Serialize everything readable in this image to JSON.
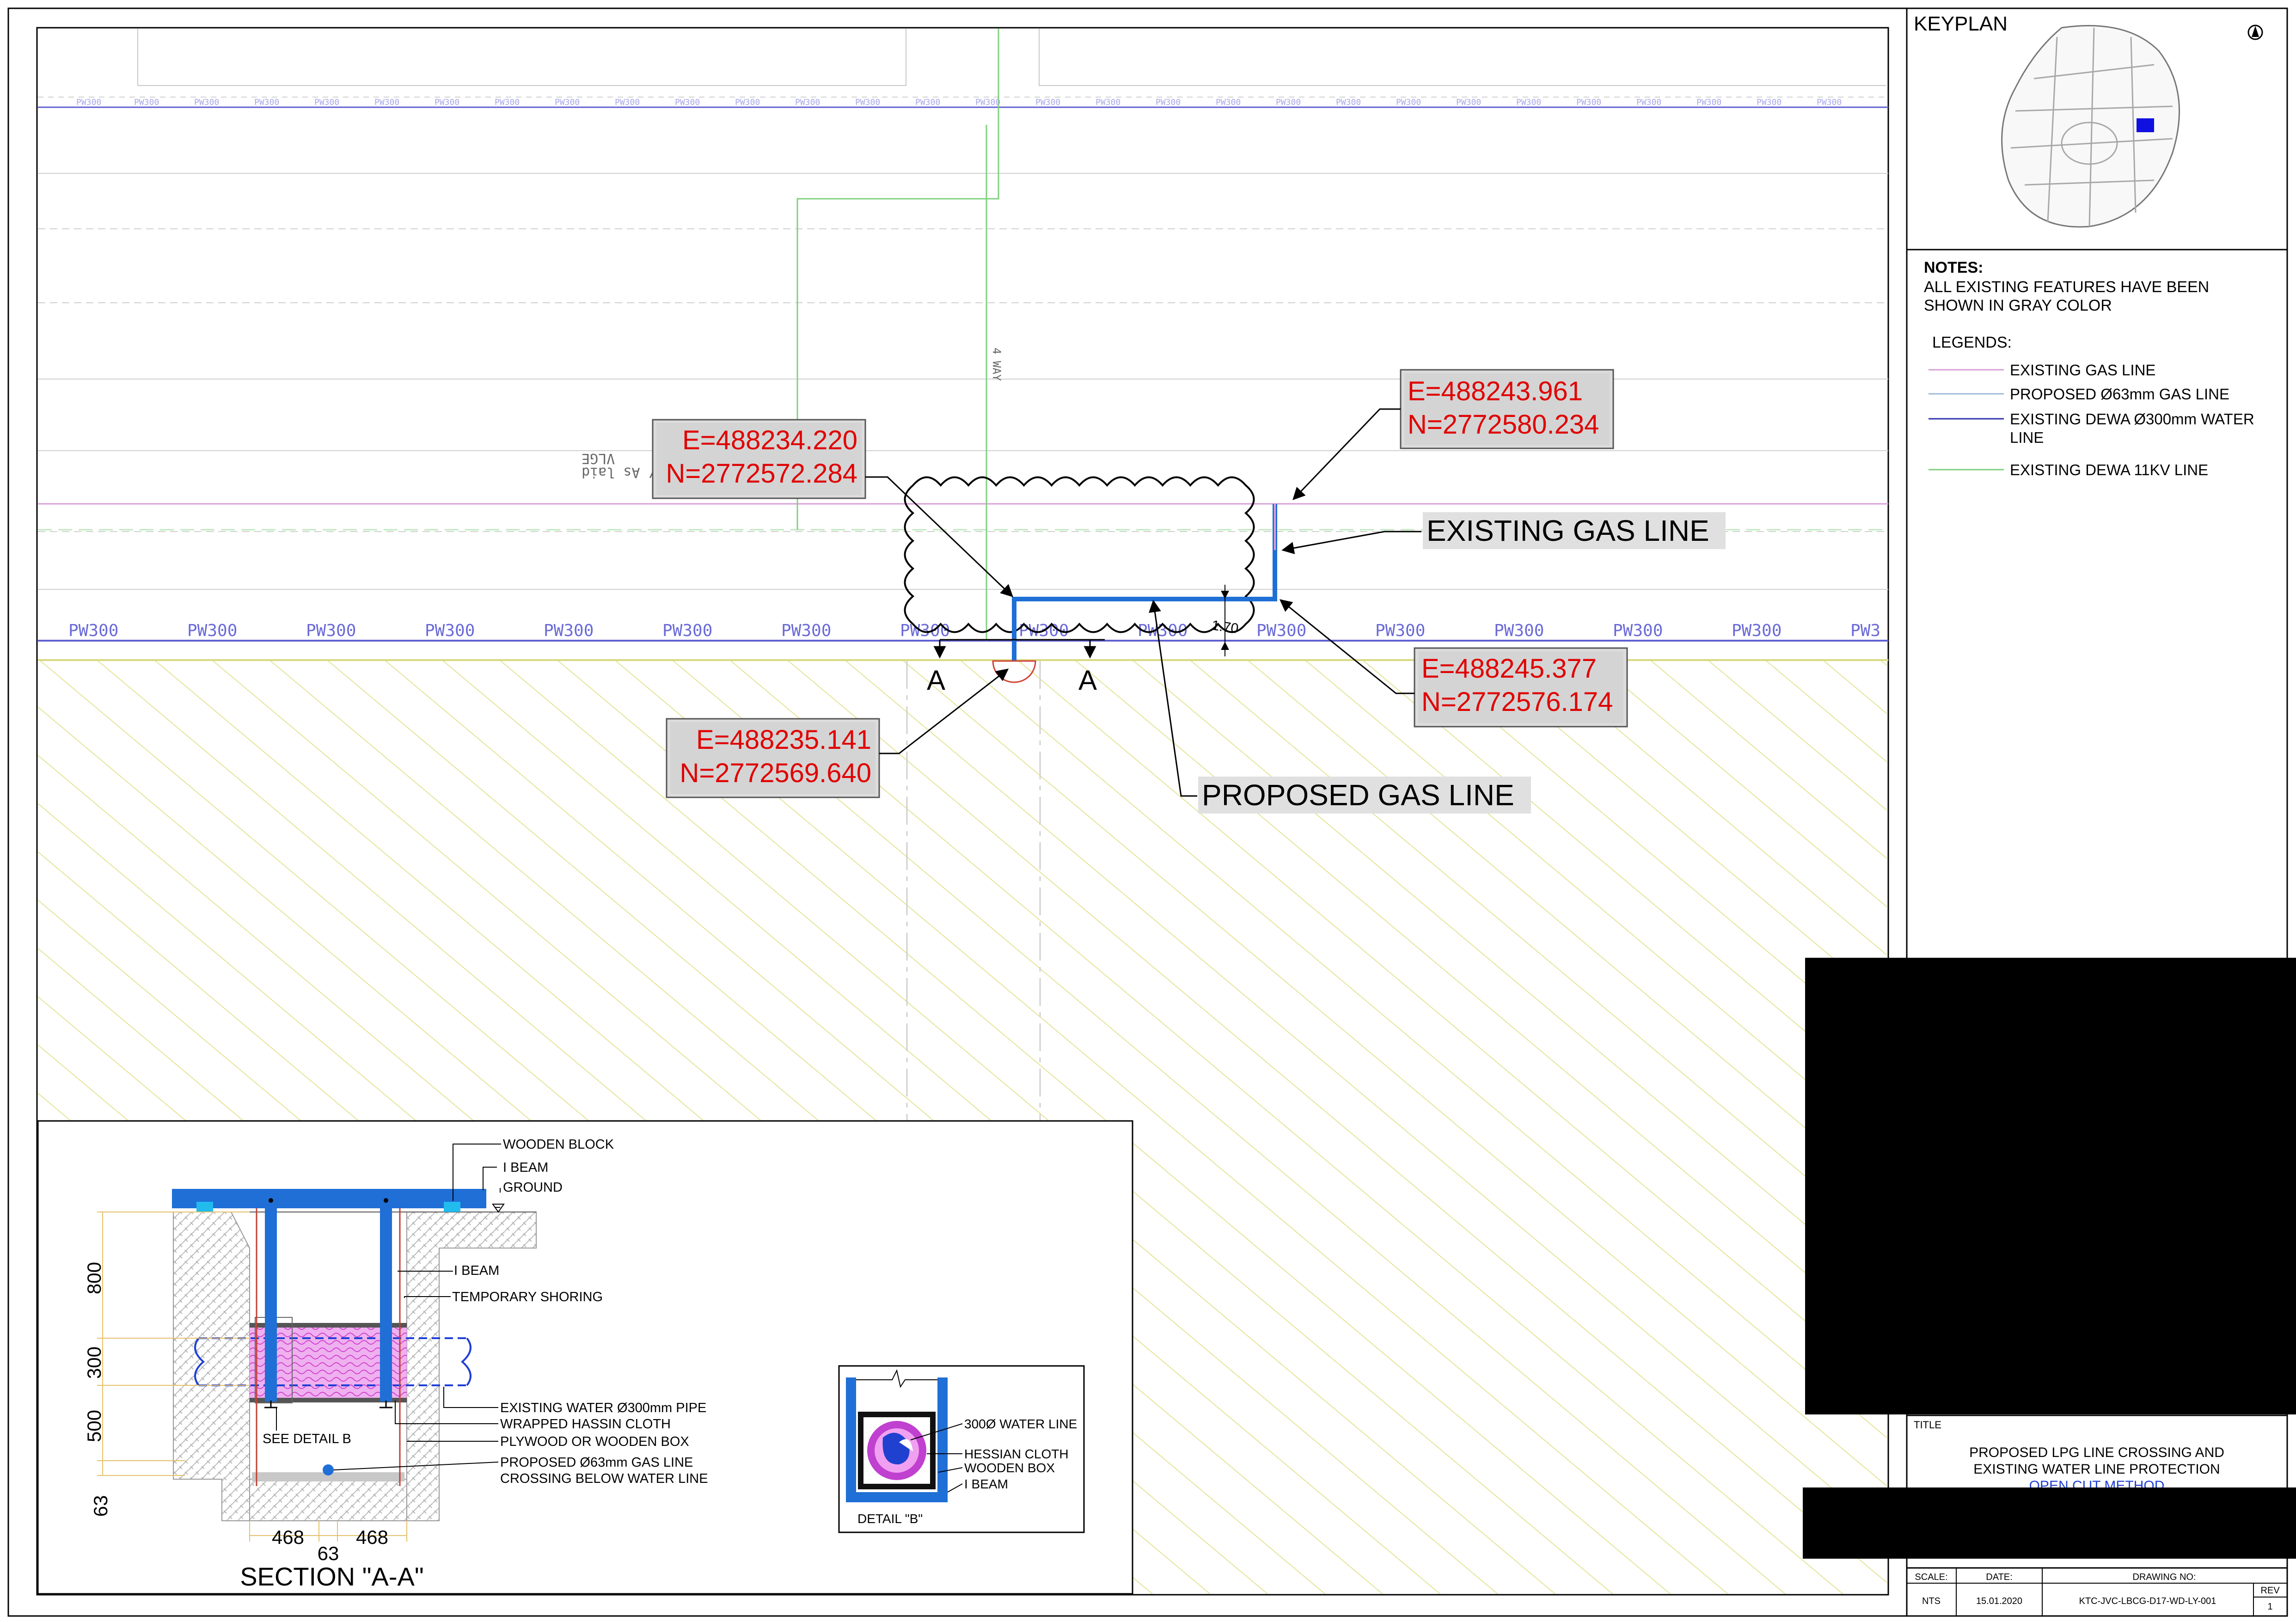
{
  "keyplan": {
    "title": "KEYPLAN"
  },
  "notes": {
    "heading": "NOTES:",
    "line1": "ALL EXISTING FEATURES HAVE BEEN",
    "line2": "SHOWN IN GRAY COLOR",
    "legends_heading": "LEGENDS:",
    "legend": [
      {
        "label": "EXISTING GAS LINE",
        "color": "#d8a0d8"
      },
      {
        "label": "PROPOSED Ø63mm GAS LINE",
        "color": "#a0b8d8"
      },
      {
        "label_line1": "EXISTING DEWA Ø300mm WATER",
        "label_line2": "LINE",
        "color": "#3030b0"
      },
      {
        "label": "EXISTING DEWA 11KV LINE",
        "color": "#80d080"
      }
    ]
  },
  "plan": {
    "pw_label": "PW300",
    "road_label": "4 WAY",
    "cable_label_line1": "11 kV Constructed/ As laid",
    "cable_label_line2": "VLGE",
    "section_marker": "A",
    "dimension": "1.70",
    "coord1": {
      "e": "E=488234.220",
      "n": "N=2772572.284"
    },
    "coord2": {
      "e": "E=488243.961",
      "n": "N=2772580.234"
    },
    "coord3": {
      "e": "E=488245.377",
      "n": "N=2772576.174"
    },
    "coord4": {
      "e": "E=488235.141",
      "n": "N=2772569.640"
    },
    "existing_gas_label": "EXISTING GAS LINE",
    "proposed_gas_label": "PROPOSED GAS LINE"
  },
  "section": {
    "title": "SECTION \"A-A\"",
    "labels": {
      "wooden_block": "WOODEN BLOCK",
      "i_beam_top": "I BEAM",
      "ground": "GROUND",
      "i_beam": "I BEAM",
      "temporary_shoring": "TEMPORARY SHORING",
      "existing_water_pipe": "EXISTING WATER Ø300mm PIPE",
      "wrapped_cloth": "WRAPPED HASSIN CLOTH",
      "plywood_box": "PLYWOOD OR WOODEN BOX",
      "proposed_gas_1": "PROPOSED Ø63mm GAS LINE",
      "proposed_gas_2": "CROSSING BELOW WATER LINE",
      "see_detail": "SEE DETAIL B"
    },
    "dims": {
      "d800": "800",
      "d300": "300",
      "d500": "500",
      "d63": "63",
      "w468a": "468",
      "w63": "63",
      "w468b": "468"
    }
  },
  "detail_b": {
    "title": "DETAIL \"B\"",
    "water_line": "300Ø WATER LINE",
    "hessian": "HESSIAN CLOTH",
    "wooden_box": "WOODEN BOX",
    "i_beam": "I BEAM"
  },
  "title_block": {
    "title_label": "TITLE",
    "title_line1": "PROPOSED LPG LINE CROSSING AND",
    "title_line2": "EXISTING WATER LINE PROTECTION",
    "title_line3": "OPEN CUT METHOD",
    "scale_label": "SCALE:",
    "date_label": "DATE:",
    "drawing_no_label": "DRAWING NO:",
    "rev_label": "REV",
    "scale": "NTS",
    "date": "15.01.2020",
    "drawing_no": "KTC-JVC-LBCG-D17-WD-LY-001",
    "rev": "1"
  }
}
